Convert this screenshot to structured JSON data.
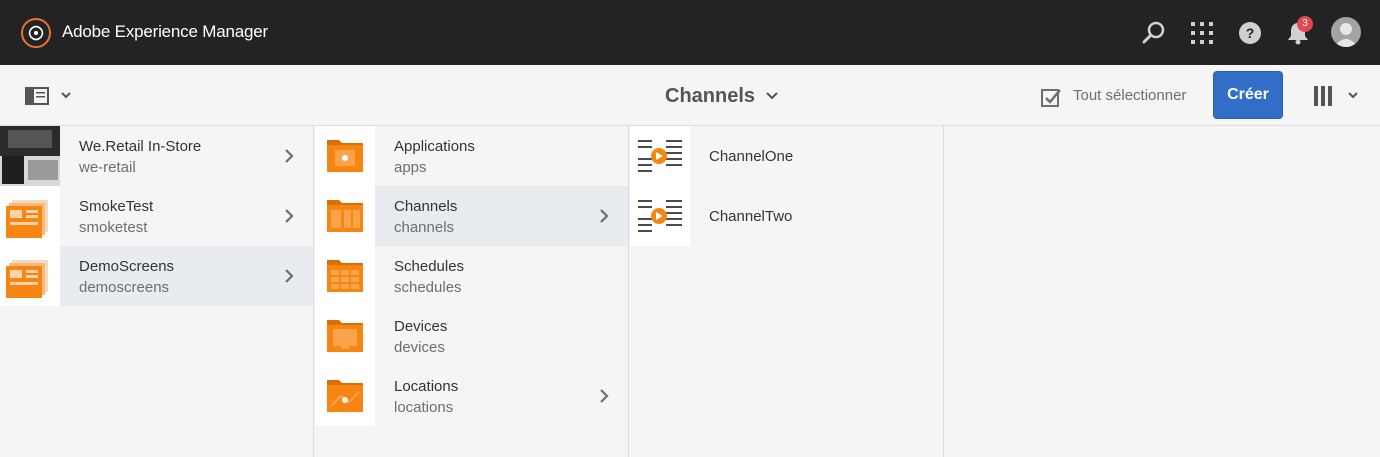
{
  "shell": {
    "brand": "Adobe Experience Manager",
    "icons": [
      "search-icon",
      "apps-grid-icon",
      "help-icon",
      "bell-icon",
      "user-avatar"
    ],
    "notification_count": "3"
  },
  "actionbar": {
    "title": "Channels",
    "select_all": "Tout sélectionner",
    "create": "Créer"
  },
  "columns": {
    "col1": [
      {
        "title": "We.Retail In-Store",
        "name": "we-retail"
      },
      {
        "title": "SmokeTest",
        "name": "smoketest"
      },
      {
        "title": "DemoScreens",
        "name": "demoscreens"
      }
    ],
    "col2": [
      {
        "title": "Applications",
        "name": "apps"
      },
      {
        "title": "Channels",
        "name": "channels"
      },
      {
        "title": "Schedules",
        "name": "schedules"
      },
      {
        "title": "Devices",
        "name": "devices"
      },
      {
        "title": "Locations",
        "name": "locations"
      }
    ],
    "col3": [
      {
        "title": "ChannelOne"
      },
      {
        "title": "ChannelTwo"
      }
    ]
  },
  "colors": {
    "shell_bg": "#232323",
    "accent": "#326ec8",
    "folder_orange": "#f68511",
    "selected_row": "#e8ebf0"
  }
}
